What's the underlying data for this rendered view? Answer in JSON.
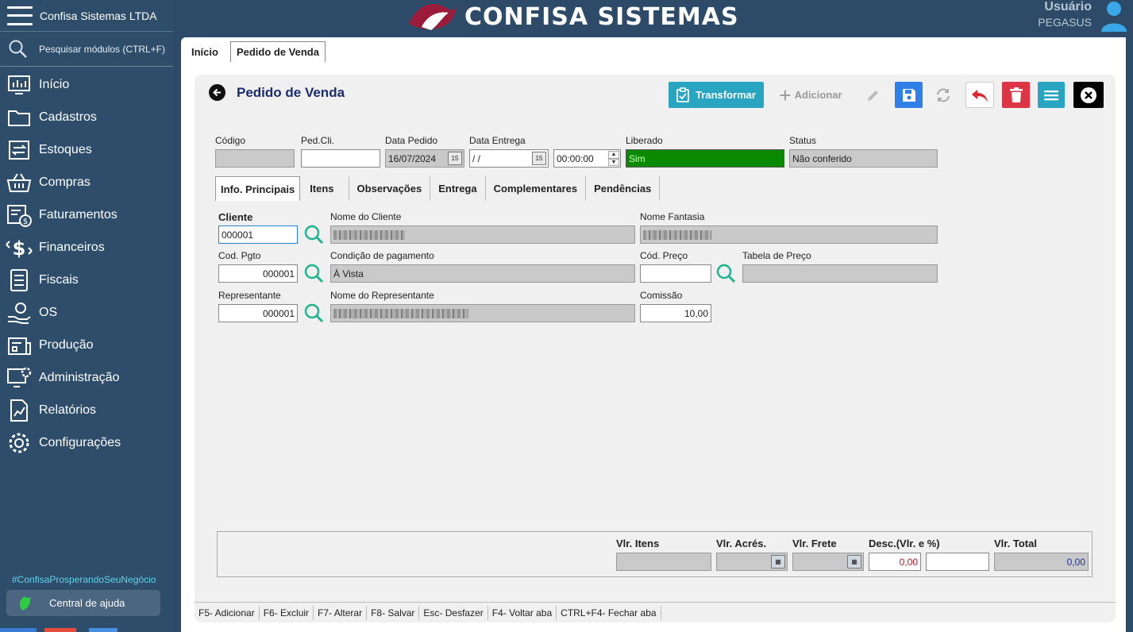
{
  "sidebar": {
    "company": "Confisa Sistemas LTDA",
    "search_placeholder": "Pesquisar módulos (CTRL+F)",
    "items": [
      {
        "label": "Início"
      },
      {
        "label": "Cadastros"
      },
      {
        "label": "Estoques"
      },
      {
        "label": "Compras"
      },
      {
        "label": "Faturamentos"
      },
      {
        "label": "Financeiros"
      },
      {
        "label": "Fiscais"
      },
      {
        "label": "OS"
      },
      {
        "label": "Produção"
      },
      {
        "label": "Administração"
      },
      {
        "label": "Relatórios"
      },
      {
        "label": "Configurações"
      }
    ],
    "hashtag": "#ConfisaProsperandoSeuNegócio",
    "help_label": "Central de ajuda"
  },
  "header": {
    "logo_text": "CONFISA SISTEMAS",
    "user_label": "Usuário",
    "user_name": "PEGASUS"
  },
  "top_tabs": [
    "Início",
    "Pedido de Venda"
  ],
  "page": {
    "title": "Pedido de Venda",
    "toolbar": {
      "transformar": "Transformar",
      "adicionar": "Adicionar"
    }
  },
  "header_fields": {
    "codigo_label": "Código",
    "codigo_value": "",
    "pedcli_label": "Ped.Cli.",
    "pedcli_value": "",
    "data_pedido_label": "Data Pedido",
    "data_pedido_value": "16/07/2024",
    "data_entrega_label": "Data Entrega",
    "data_entrega_value": " / /",
    "hora_value": "00:00:00",
    "liberado_label": "Liberado",
    "liberado_value": "Sim",
    "status_label": "Status",
    "status_value": "Não conferido"
  },
  "inner_tabs": [
    "Info. Principais",
    "Itens",
    "Observações",
    "Entrega",
    "Complementares",
    "Pendências"
  ],
  "main_fields": {
    "cliente_label": "Cliente",
    "cliente_value": "000001",
    "nome_cliente_label": "Nome do Cliente",
    "nome_fantasia_label": "Nome Fantasia",
    "cod_pgto_label": "Cod. Pgto",
    "cod_pgto_value": "000001",
    "condicao_label": "Condição de pagamento",
    "condicao_value": "À Vista",
    "cod_preco_label": "Cód. Preço",
    "cod_preco_value": "",
    "tabela_preco_label": "Tabela de Preço",
    "tabela_preco_value": "",
    "representante_label": "Representante",
    "representante_value": "000001",
    "nome_representante_label": "Nome do Representante",
    "comissao_label": "Comissão",
    "comissao_value": "10,00"
  },
  "totals": {
    "vlr_itens_label": "Vlr. Itens",
    "vlr_itens_value": "",
    "vlr_acres_label": "Vlr. Acrés.",
    "vlr_frete_label": "Vlr. Frete",
    "desc_label": "Desc.(Vlr. e %)",
    "desc_value": "0,00",
    "desc_pct_value": "",
    "vlr_total_label": "Vlr. Total",
    "vlr_total_value": "0,00"
  },
  "shortcuts": [
    "F5- Adicionar",
    "F6- Excluir",
    "F7- Alterar",
    "F8- Salvar",
    "Esc- Desfazer",
    "F4- Voltar aba",
    "CTRL+F4- Fechar aba"
  ],
  "colors": {
    "sidebar_bg": "#2e4d6b",
    "accent_teal": "#2aa5c1",
    "save_blue": "#2f7fe6",
    "delete_red": "#dc3545",
    "liberado_green": "#0a8a00",
    "title_navy": "#1b2c6e"
  }
}
